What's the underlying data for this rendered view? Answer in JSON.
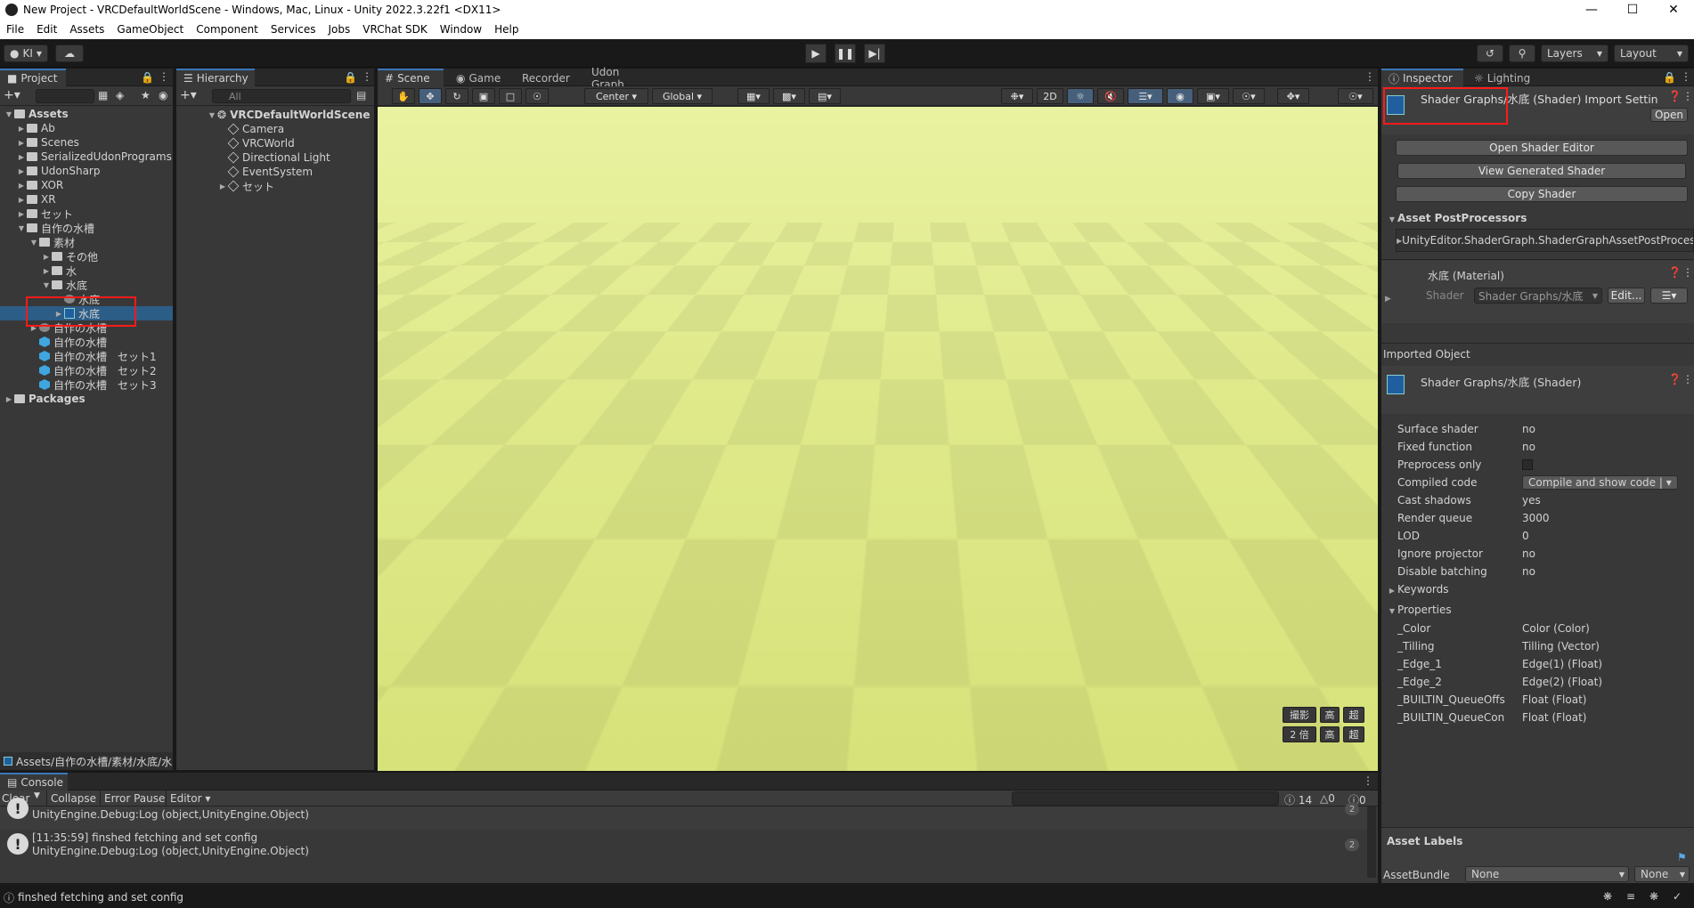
{
  "window": {
    "title": "New Project - VRCDefaultWorldScene - Windows, Mac, Linux - Unity 2022.3.22f1 <DX11>"
  },
  "menu": [
    "File",
    "Edit",
    "Assets",
    "GameObject",
    "Component",
    "Services",
    "Jobs",
    "VRChat SDK",
    "Window",
    "Help"
  ],
  "toolbar": {
    "account": "KI",
    "layers_label": "Layers",
    "layout_label": "Layout"
  },
  "project": {
    "tab": "Project",
    "items": [
      {
        "label": "Assets",
        "depth": 0,
        "icon": "folder",
        "arrow": "down",
        "bold": true
      },
      {
        "label": "Ab",
        "depth": 1,
        "icon": "folder",
        "arrow": "right"
      },
      {
        "label": "Scenes",
        "depth": 1,
        "icon": "folder",
        "arrow": "right"
      },
      {
        "label": "SerializedUdonPrograms",
        "depth": 1,
        "icon": "folder",
        "arrow": "right"
      },
      {
        "label": "UdonSharp",
        "depth": 1,
        "icon": "folder",
        "arrow": "right"
      },
      {
        "label": "XOR",
        "depth": 1,
        "icon": "folder",
        "arrow": "right"
      },
      {
        "label": "XR",
        "depth": 1,
        "icon": "folder",
        "arrow": "right"
      },
      {
        "label": "セット",
        "depth": 1,
        "icon": "folder",
        "arrow": "right"
      },
      {
        "label": "自作の水槽",
        "depth": 1,
        "icon": "folder",
        "arrow": "down"
      },
      {
        "label": "素材",
        "depth": 2,
        "icon": "folder",
        "arrow": "down"
      },
      {
        "label": "その他",
        "depth": 3,
        "icon": "folder",
        "arrow": "right"
      },
      {
        "label": "水",
        "depth": 3,
        "icon": "folder",
        "arrow": "right"
      },
      {
        "label": "水底",
        "depth": 3,
        "icon": "folder",
        "arrow": "down"
      },
      {
        "label": "水底",
        "depth": 4,
        "icon": "material",
        "arrow": ""
      },
      {
        "label": "水底",
        "depth": 4,
        "icon": "shader",
        "arrow": "right",
        "selected": true
      },
      {
        "label": "自作の水槽",
        "depth": 2,
        "icon": "material",
        "arrow": "right"
      },
      {
        "label": "自作の水槽",
        "depth": 2,
        "icon": "prefab",
        "arrow": ""
      },
      {
        "label": "自作の水槽　セット1",
        "depth": 2,
        "icon": "prefab",
        "arrow": ""
      },
      {
        "label": "自作の水槽　セット2",
        "depth": 2,
        "icon": "prefab",
        "arrow": ""
      },
      {
        "label": "自作の水槽　セット3",
        "depth": 2,
        "icon": "prefab",
        "arrow": ""
      },
      {
        "label": "Packages",
        "depth": 0,
        "icon": "folder",
        "arrow": "right",
        "bold": true
      }
    ],
    "path": "Assets/自作の水槽/素材/水底/水"
  },
  "hierarchy": {
    "tab": "Hierarchy",
    "search_placeholder": "All",
    "scene": "VRCDefaultWorldScene",
    "items": [
      "Camera",
      "VRCWorld",
      "Directional Light",
      "EventSystem",
      "セット"
    ]
  },
  "scene_tabs": [
    "Scene",
    "Game",
    "Recorder",
    "Udon Graph"
  ],
  "scene_toolbar": {
    "pivot": "Center",
    "space": "Global",
    "mode2d": "2D"
  },
  "scene_overlay": {
    "row1": [
      "撮影",
      "高",
      "超"
    ],
    "row2": [
      "2 倍",
      "高",
      "超"
    ]
  },
  "inspector": {
    "tabs": [
      "Inspector",
      "Lighting"
    ],
    "title": "Shader Graphs/水底 (Shader) Import Settin",
    "open_label": "Open",
    "buttons": [
      "Open Shader Editor",
      "View Generated Shader",
      "Copy Shader"
    ],
    "postprocessors_header": "Asset PostProcessors",
    "postprocessor": "UnityEditor.ShaderGraph.ShaderGraphAssetPostProcess",
    "material": {
      "title": "水底 (Material)",
      "shader_label": "Shader",
      "shader_value": "Shader Graphs/水底",
      "edit_label": "Edit..."
    },
    "imported_header": "Imported Object",
    "imported_title": "Shader Graphs/水底 (Shader)",
    "props": [
      {
        "k": "Surface shader",
        "v": "no"
      },
      {
        "k": "Fixed function",
        "v": "no"
      },
      {
        "k": "Preprocess only",
        "v": ""
      },
      {
        "k": "Compiled code",
        "v": "Compile and show code"
      },
      {
        "k": "Cast shadows",
        "v": "yes"
      },
      {
        "k": "Render queue",
        "v": "3000"
      },
      {
        "k": "LOD",
        "v": "0"
      },
      {
        "k": "Ignore projector",
        "v": "no"
      },
      {
        "k": "Disable batching",
        "v": "no"
      }
    ],
    "keywords_label": "Keywords",
    "properties_label": "Properties",
    "properties": [
      {
        "k": "_Color",
        "v": "Color (Color)"
      },
      {
        "k": "_Tilling",
        "v": "Tilling (Vector)"
      },
      {
        "k": "_Edge_1",
        "v": "Edge(1) (Float)"
      },
      {
        "k": "_Edge_2",
        "v": "Edge(2) (Float)"
      },
      {
        "k": "_BUILTIN_QueueOffs",
        "v": "Float (Float)"
      },
      {
        "k": "_BUILTIN_QueueCon",
        "v": "Float (Float)"
      }
    ],
    "asset_labels": "Asset Labels",
    "assetbundle_label": "AssetBundle",
    "assetbundle_value": "None",
    "assetbundle_variant": "None"
  },
  "console": {
    "tab": "Console",
    "buttons": [
      "Clear",
      "Collapse",
      "Error Pause",
      "Editor"
    ],
    "counts": {
      "info": "14",
      "warn": "0",
      "error": "0"
    },
    "rows": [
      {
        "line1": "",
        "line2": "UnityEngine.Debug:Log (object,UnityEngine.Object)",
        "count": "2"
      },
      {
        "line1": "[11:35:59] finshed fetching and set config",
        "line2": "UnityEngine.Debug:Log (object,UnityEngine.Object)",
        "count": "2"
      }
    ]
  },
  "status_bar": "finshed fetching and set config",
  "colors": {
    "accent": "#3a79bb",
    "selection": "#2c5d87",
    "highlight": "#ff1a1a"
  }
}
